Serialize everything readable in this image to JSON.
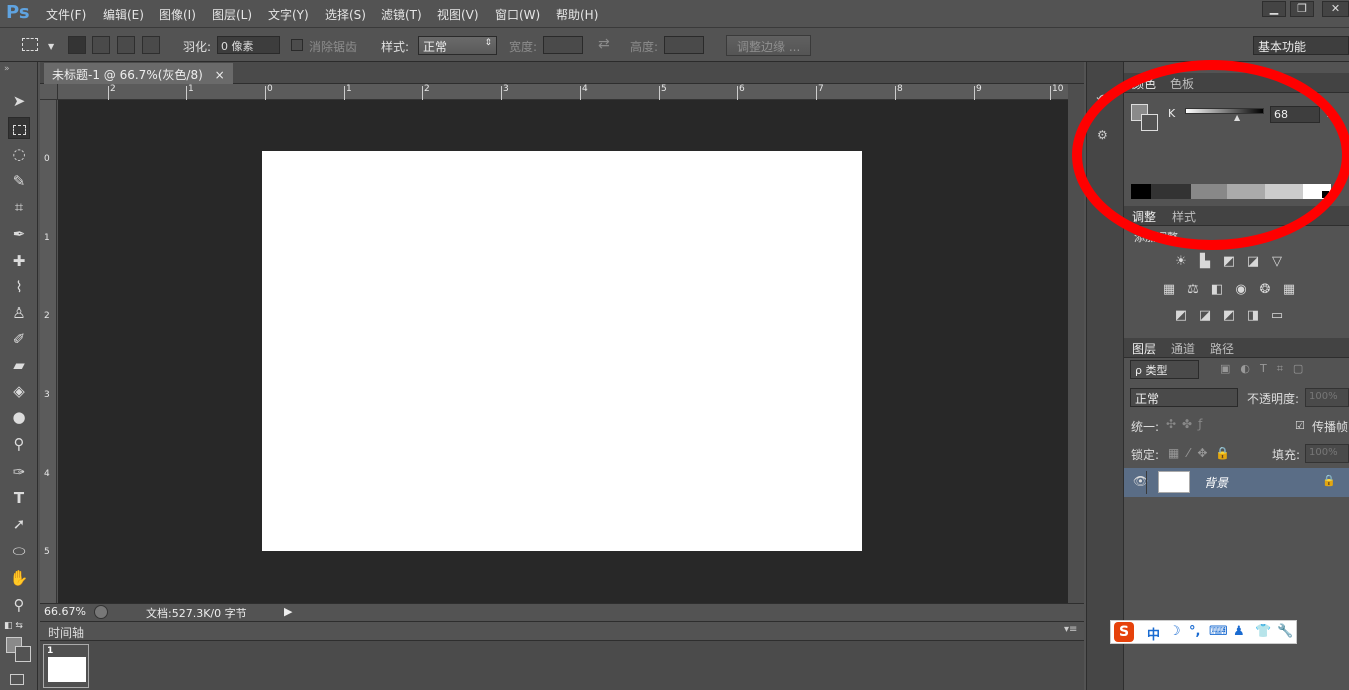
{
  "app": {
    "logo": "Ps"
  },
  "menu": [
    "文件(F)",
    "编辑(E)",
    "图像(I)",
    "图层(L)",
    "文字(Y)",
    "选择(S)",
    "滤镜(T)",
    "视图(V)",
    "窗口(W)",
    "帮助(H)"
  ],
  "window_controls": {
    "minimize": "▁",
    "restore": "❐",
    "close": "✕"
  },
  "options": {
    "feather_label": "羽化:",
    "feather_value": "0 像素",
    "antialias_label": "消除锯齿",
    "style_label": "样式:",
    "style_value": "正常",
    "width_label": "宽度:",
    "height_label": "高度:",
    "refine_edge": "调整边缘 ...",
    "workspace": "基本功能"
  },
  "document": {
    "tab_title": "未标题-1 @ 66.7%(灰色/8)",
    "tab_close": "×",
    "ruler_top": [
      "2",
      "1",
      "0",
      "1",
      "2",
      "3",
      "4",
      "5",
      "6",
      "7",
      "8",
      "9",
      "10"
    ],
    "ruler_left": [
      "0",
      "1",
      "2",
      "3",
      "4",
      "5"
    ]
  },
  "status": {
    "zoom": "66.67%",
    "doc_info": "文档:527.3K/0 字节"
  },
  "timeline": {
    "title": "时间轴",
    "frame_number": "1"
  },
  "color_panel": {
    "tabs": [
      "颜色",
      "色板"
    ],
    "channel_label": "K",
    "value": "68",
    "unit": "%",
    "fill_color": "#8a8a8a"
  },
  "adjustments_panel": {
    "tabs": [
      "调整",
      "样式"
    ],
    "subtitle": "添加调整"
  },
  "layers_panel": {
    "tabs": [
      "图层",
      "通道",
      "路径"
    ],
    "filter_label": "ρ 类型",
    "blend_mode": "正常",
    "opacity_label": "不透明度:",
    "opacity_value": "100%",
    "unify_label": "统一:",
    "propagate_label": "传播帧",
    "lock_label": "锁定:",
    "fill_label": "填充:",
    "fill_value": "100%",
    "layers": [
      {
        "name": "背景",
        "visible": true,
        "locked": true
      }
    ]
  },
  "ime": {
    "logo": "S",
    "mode": "中"
  },
  "colors": {
    "annotation": "#ff0000",
    "ps_blue": "#5fa3e0",
    "canvas_bg": "#282828"
  }
}
